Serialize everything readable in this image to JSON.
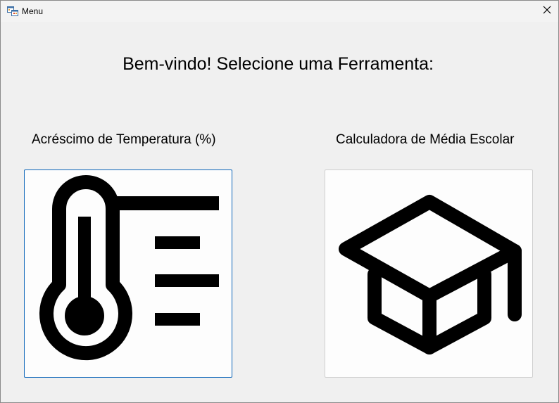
{
  "window": {
    "title": "Menu",
    "icon": "winforms-app-icon",
    "close_icon": "close-icon"
  },
  "main": {
    "heading": "Bem-vindo! Selecione uma Ferramenta:",
    "tools": [
      {
        "label": "Acréscimo de Temperatura (%)",
        "icon": "thermometer-icon",
        "focused": true
      },
      {
        "label": "Calculadora de Média Escolar",
        "icon": "graduation-cap-icon",
        "focused": false
      }
    ]
  },
  "colors": {
    "window_bg": "#f0f0f0",
    "focus_border": "#0a64b8",
    "icon": "#000000"
  }
}
